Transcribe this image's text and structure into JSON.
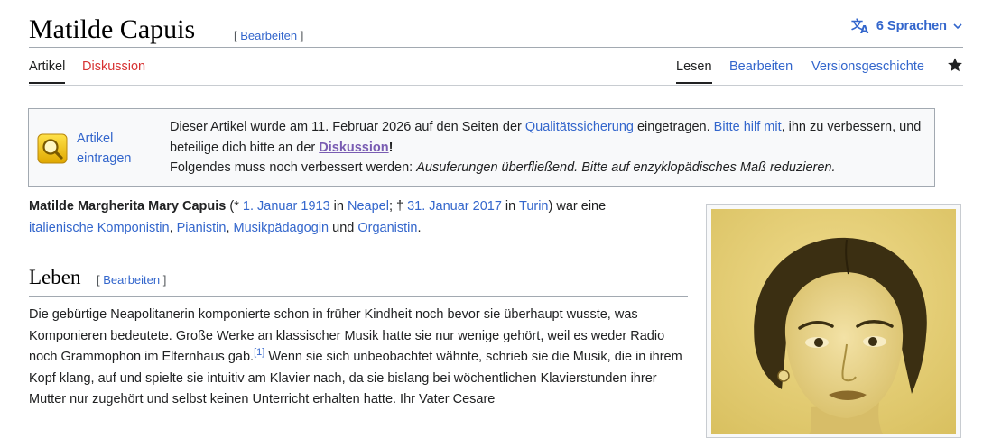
{
  "header": {
    "title": "Matilde Capuis",
    "edit_open": "[ ",
    "edit_label": "Bearbeiten",
    "edit_close": " ]",
    "languages_label": "6 Sprachen"
  },
  "tabs": {
    "article": "Artikel",
    "discussion": "Diskussion",
    "read": "Lesen",
    "edit": "Bearbeiten",
    "history": "Versionsgeschichte"
  },
  "ambox": {
    "side_line1": "Artikel",
    "side_line2": "eintragen",
    "t1": "Dieser Artikel wurde am 11. Februar 2026 auf den Seiten der ",
    "link_qs": "Qualitätssicherung",
    "t2": " eingetragen. ",
    "link_help": "Bitte hilf mit",
    "t3": ", ihn zu verbessern, und beteilige dich bitte an der ",
    "link_disc": "Diskussion",
    "t4": "!",
    "t5": "Folgendes muss noch verbessert werden: ",
    "t6": "Ausuferungen überfließend. Bitte auf enzyklopädisches Maß reduzieren."
  },
  "lead": {
    "name": "Matilde Margherita Mary Capuis",
    "p1": " (* ",
    "birth_date": "1. Januar 1913",
    "p2": " in ",
    "birth_place": "Neapel",
    "p3": "; † ",
    "death_date": "31. Januar 2017",
    "p4": " in ",
    "death_place": "Turin",
    "p5": ") war eine ",
    "link_composer": "italienische Komponistin",
    "p6": ", ",
    "link_pianist": "Pianistin",
    "p7": ", ",
    "link_teacher": "Musikpädagogin",
    "p8": " und ",
    "link_organist": "Organistin",
    "p9": "."
  },
  "section": {
    "title": "Leben",
    "edit_open": "[ ",
    "edit_label": "Bearbeiten",
    "edit_close": " ]"
  },
  "body": {
    "t1": "Die gebürtige Neapolitanerin komponierte schon in früher Kindheit noch bevor sie überhaupt wusste, was Komponieren bedeutete. Große Werke an klassischer Musik hatte sie nur wenige gehört, weil es weder Radio noch Grammophon im Elternhaus gab.",
    "ref": "[1]",
    "t2": " Wenn sie sich unbeobachtet wähnte, schrieb sie die Musik, die in ihrem Kopf klang, auf und spielte sie intuitiv am Klavier nach, da sie bislang bei wöchentlichen Klavierstunden ihrer Mutter nur zugehört und selbst keinen Unterricht erhalten hatte. Ihr Vater Cesare"
  },
  "colors": {
    "link": "#3366cc",
    "red_link": "#d73333",
    "visited": "#795cb2",
    "text": "#202122"
  },
  "icons": {
    "languages": "translate-icon",
    "chevron": "chevron-down-icon",
    "watch": "star-icon",
    "ambox": "magnifier-icon"
  }
}
